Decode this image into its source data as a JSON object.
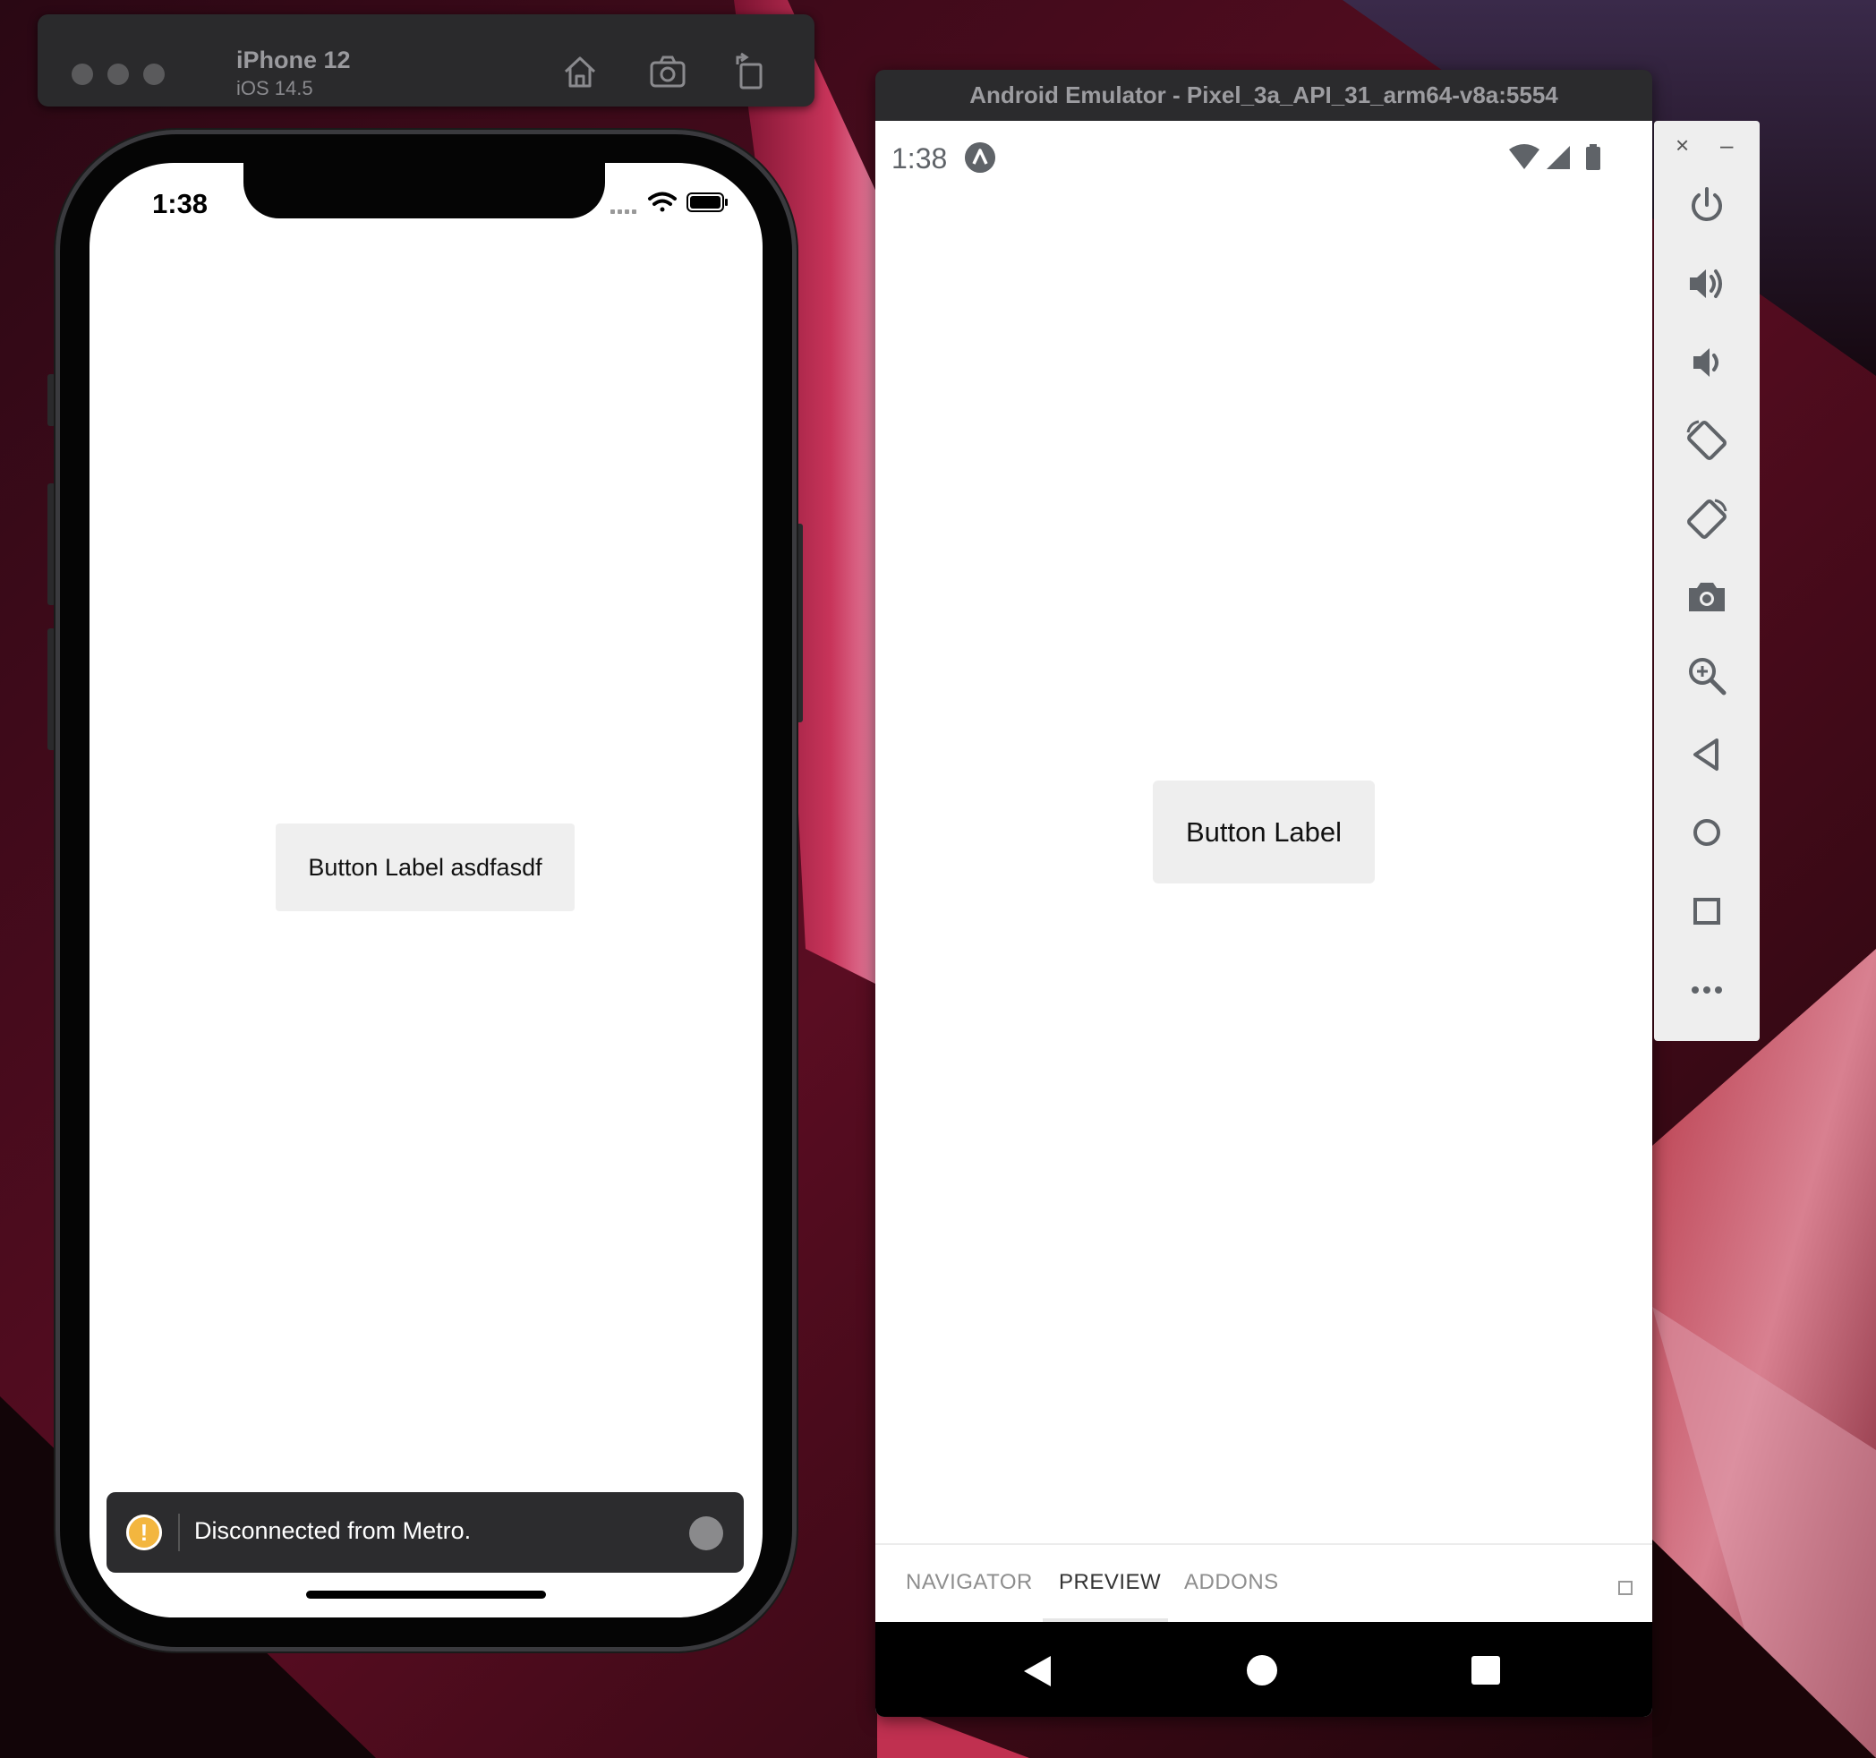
{
  "ios_simulator": {
    "device_name": "iPhone 12",
    "os_version": "iOS 14.5",
    "toolbar": [
      "home-icon",
      "screenshot-icon",
      "rotate-icon"
    ],
    "status_time": "1:38",
    "button_label": "Button Label asdfasdf",
    "toast": {
      "icon": "!",
      "message": "Disconnected from Metro."
    }
  },
  "android_emulator": {
    "window_title": "Android Emulator - Pixel_3a_API_31_arm64-v8a:5554",
    "status_time": "1:38",
    "button_label": "Button Label",
    "devtools_tabs": [
      {
        "label": "NAVIGATOR",
        "active": false
      },
      {
        "label": "PREVIEW",
        "active": true
      },
      {
        "label": "ADDONS",
        "active": false
      }
    ],
    "window_controls": {
      "close": "×",
      "minimize": "–"
    },
    "sidebar_icons": [
      "power-icon",
      "volume-up-icon",
      "volume-down-icon",
      "rotate-left-icon",
      "rotate-right-icon",
      "camera-icon",
      "zoom-icon",
      "back-icon",
      "home-icon",
      "overview-icon",
      "more-icon"
    ]
  },
  "colors": {
    "toast_background": "#2c2c2e",
    "warning": "#f3b63f",
    "button_background": "#efefef"
  }
}
